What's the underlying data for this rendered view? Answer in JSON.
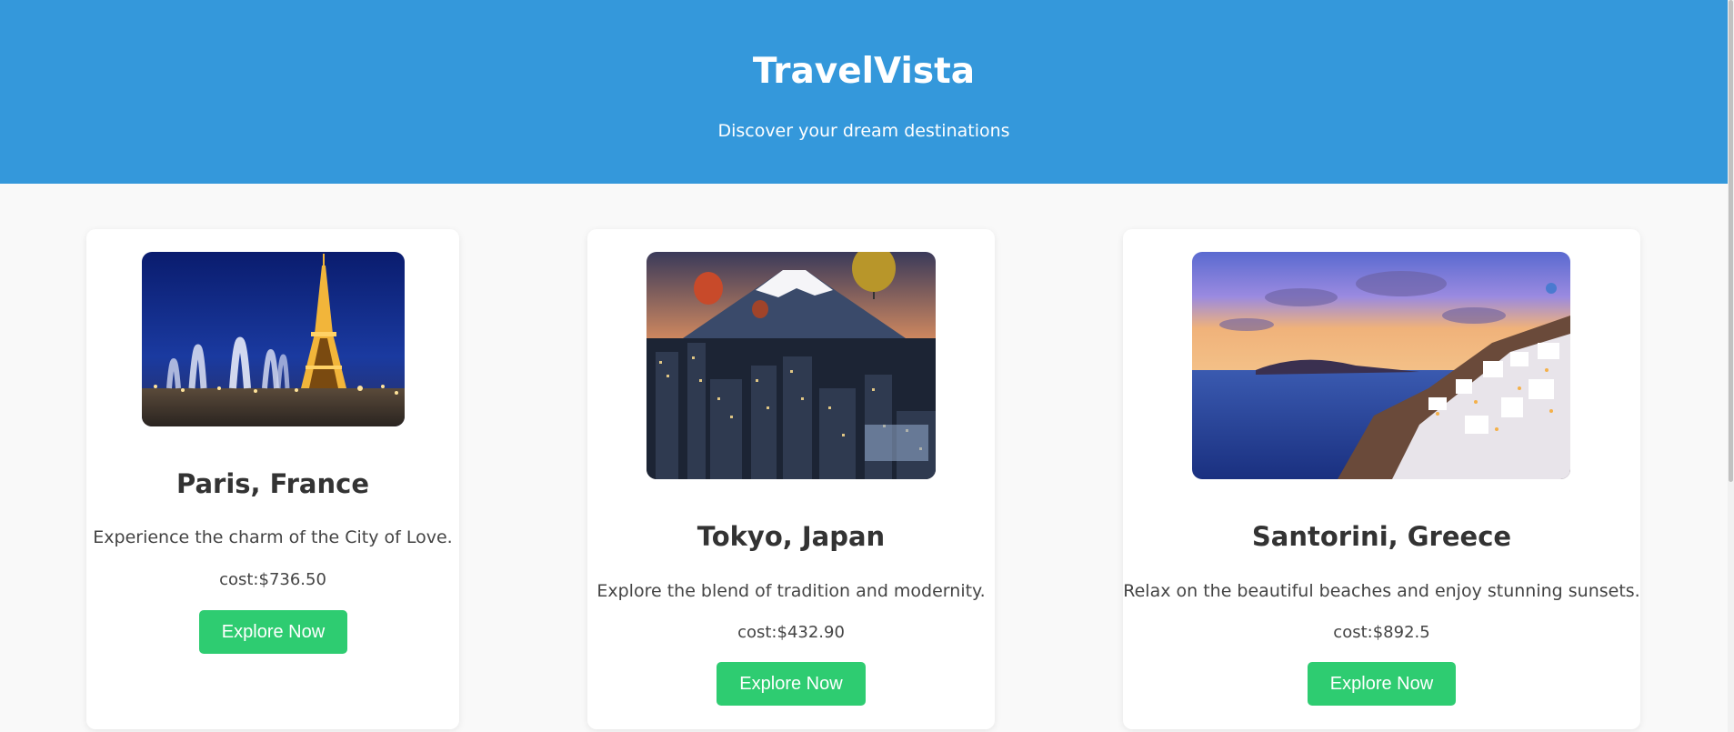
{
  "header": {
    "title": "TravelVista",
    "tagline": "Discover your dream destinations"
  },
  "destinations": [
    {
      "name": "Paris, France",
      "description": "Experience the charm of the City of Love.",
      "cost": "cost:$736.50",
      "button_label": "Explore Now",
      "image": "eiffel-tower-night-photo"
    },
    {
      "name": "Tokyo, Japan",
      "description": "Explore the blend of tradition and modernity.",
      "cost": "cost:$432.90",
      "button_label": "Explore Now",
      "image": "mount-fuji-city-balloons-photo"
    },
    {
      "name": "Santorini, Greece",
      "description": "Relax on the beautiful beaches and enjoy stunning sunsets.",
      "cost": "cost:$892.5",
      "button_label": "Explore Now",
      "image": "santorini-sunset-village-photo"
    }
  ],
  "colors": {
    "header_bg": "#3498db",
    "button_bg": "#2ecc71",
    "page_bg": "#f9f9f9"
  }
}
